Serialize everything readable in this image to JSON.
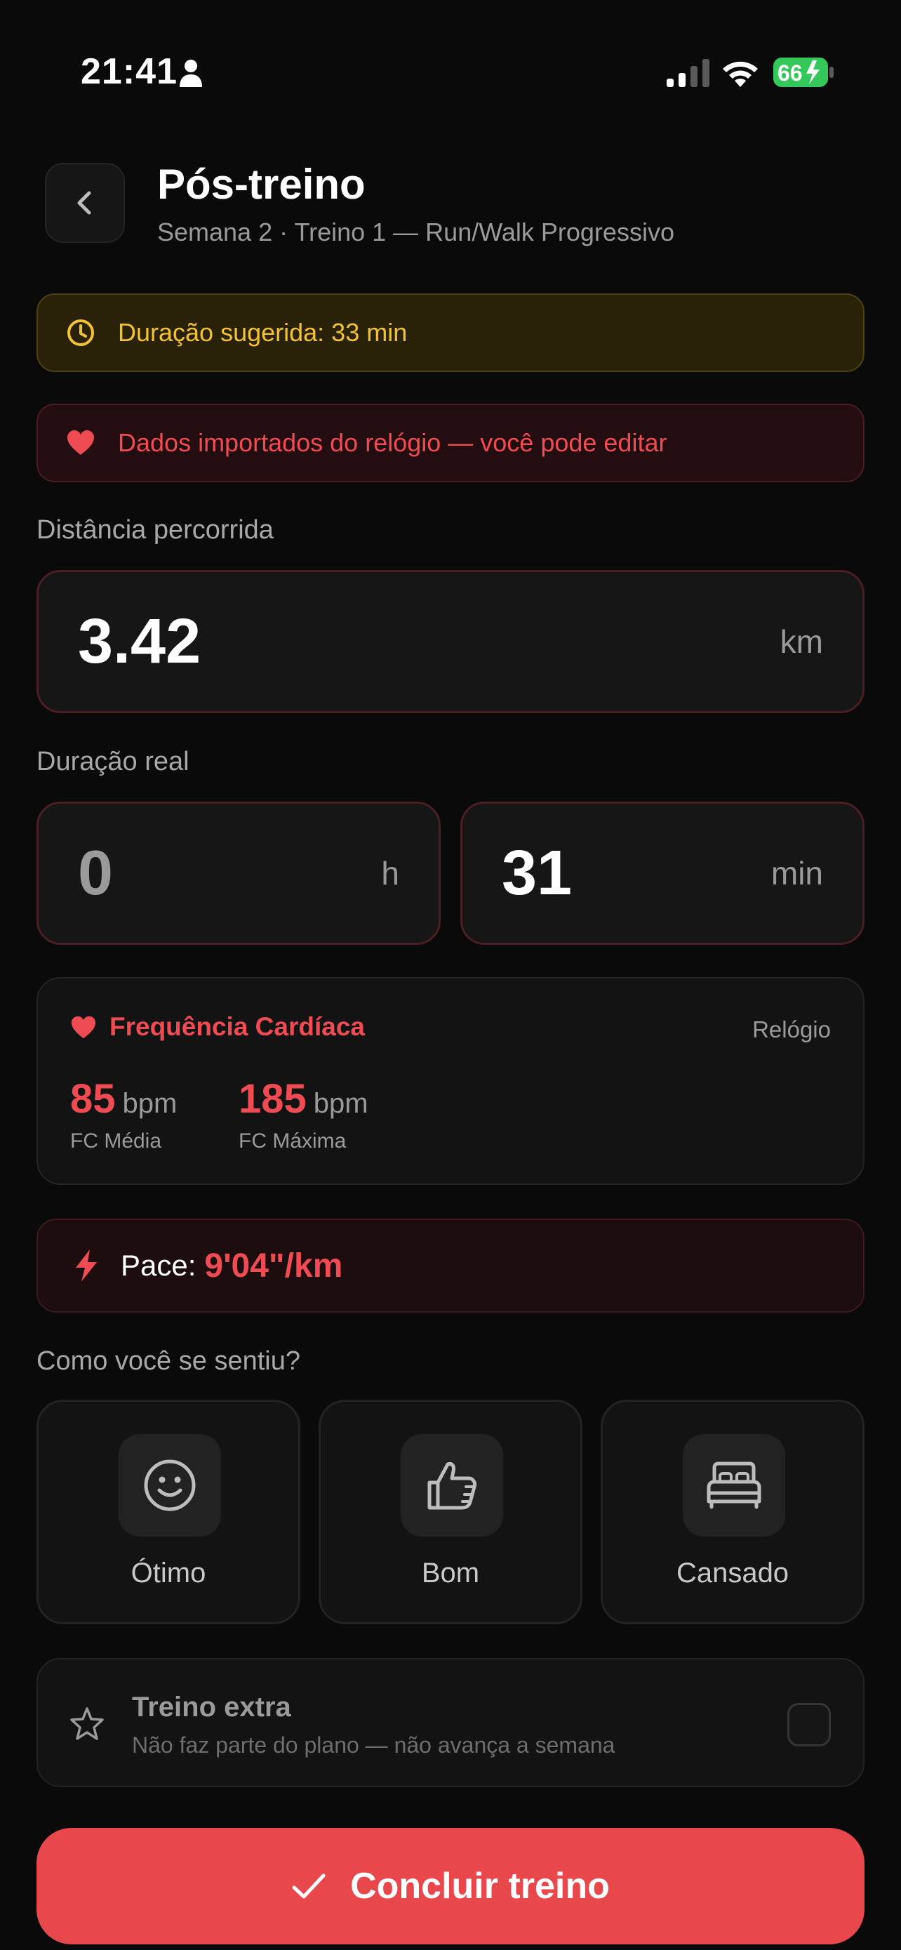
{
  "status_bar": {
    "time": "21:41",
    "battery": "66"
  },
  "header": {
    "title": "Pós-treino",
    "subtitle": "Semana 2 · Treino 1 — Run/Walk Progressivo"
  },
  "banners": {
    "duration": "Duração sugerida: 33 min",
    "watch": "Dados importados do relógio — você pode editar"
  },
  "distance": {
    "label": "Distância percorrida",
    "value": "3.42",
    "unit": "km"
  },
  "duration": {
    "label": "Duração real",
    "hours": "0",
    "hours_unit": "h",
    "minutes": "31",
    "minutes_unit": "min"
  },
  "heart_rate": {
    "title": "Frequência Cardíaca",
    "source": "Relógio",
    "avg_value": "85",
    "avg_unit": "bpm",
    "avg_label": "FC Média",
    "max_value": "185",
    "max_unit": "bpm",
    "max_label": "FC Máxima"
  },
  "pace": {
    "label": "Pace:",
    "value": "9'04\"/km"
  },
  "feeling": {
    "question": "Como você se sentiu?",
    "options": [
      {
        "label": "Ótimo",
        "icon": "smile-icon"
      },
      {
        "label": "Bom",
        "icon": "thumbs-up-icon"
      },
      {
        "label": "Cansado",
        "icon": "bed-icon"
      }
    ]
  },
  "extra": {
    "title": "Treino extra",
    "description": "Não faz parte do plano — não avança a semana",
    "checked": false
  },
  "finish_button": {
    "label": "Concluir treino"
  },
  "colors": {
    "accent_red": "#e8474b",
    "warning_yellow": "#f2c230",
    "background": "#0a0a0a",
    "battery_green": "#34c759"
  }
}
